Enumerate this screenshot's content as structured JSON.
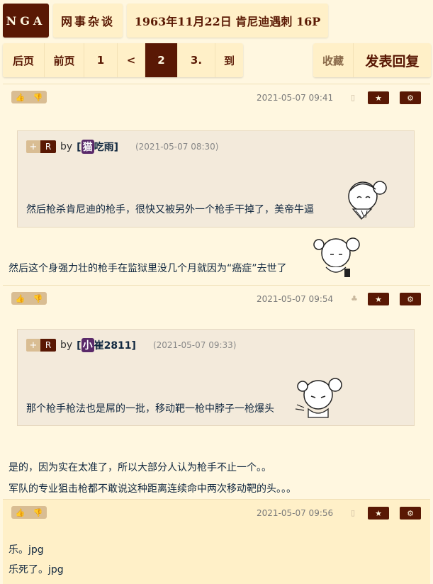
{
  "crumbs": {
    "logo": "NGA",
    "forum": "网事杂谈",
    "thread": "1963年11月22日 肯尼迪遇刺 16P"
  },
  "pager": {
    "last": "后页",
    "prev": "前页",
    "p1": "1",
    "lt": "<",
    "current": "2",
    "p3": "3.",
    "goto": "到"
  },
  "actions": {
    "favorite": "收藏",
    "reply": "发表回复"
  },
  "posts": [
    {
      "time": "2021-05-07 09:41",
      "quote": {
        "plus": "+",
        "r": "R",
        "by": "by",
        "badge": "猫",
        "user": "吃雨]",
        "open": "[",
        "time": "(2021-05-07 08:30)",
        "text": "然后枪杀肯尼迪的枪手，很快又被另外一个枪手干掉了，美帝牛逼"
      },
      "body": [
        "然后这个身强力壮的枪手在监狱里没几个月就因为“癌症”去世了"
      ]
    },
    {
      "time": "2021-05-07 09:54",
      "quote": {
        "plus": "+",
        "r": "R",
        "by": "by",
        "badge": "小",
        "user": "崔2811]",
        "open": "[",
        "time": "(2021-05-07 09:33)",
        "text": "那个枪手枪法也是屌的一批，移动靶一枪中脖子一枪爆头"
      },
      "body": [
        "是的，因为实在太准了，所以大部分人认为枪手不止一个。。",
        "军队的专业狙击枪都不敢说这种距离连续命中两次移动靶的头。。。"
      ]
    },
    {
      "time": "2021-05-07 09:56",
      "body": [
        "乐。jpg",
        "乐死了。jpg"
      ]
    }
  ],
  "colors": {
    "brand": "#591804",
    "bg": "#fff7e0",
    "tab": "#fff0c8"
  }
}
